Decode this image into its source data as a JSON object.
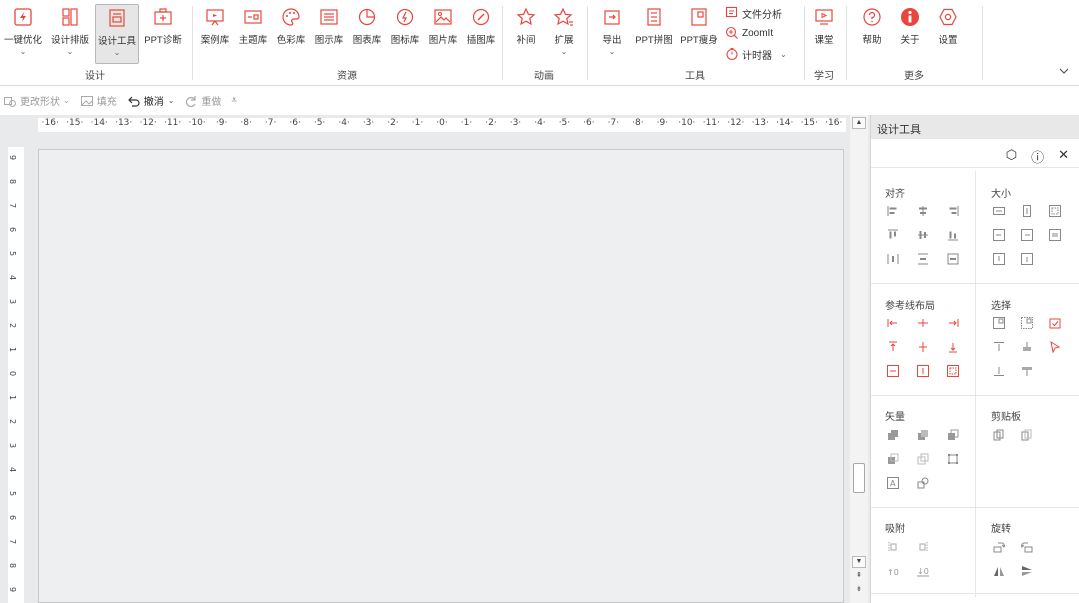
{
  "ribbon": {
    "design": {
      "label": "设计",
      "buttons": [
        {
          "label": "一键优化",
          "icon": "lightning-icon",
          "dropdown": true
        },
        {
          "label": "设计排版",
          "icon": "layout-icon",
          "dropdown": true
        },
        {
          "label": "设计工具",
          "icon": "design-tool-icon",
          "dropdown": true,
          "selected": true
        },
        {
          "label": "PPT诊断",
          "icon": "medical-kit-icon"
        }
      ]
    },
    "resources": {
      "label": "资源",
      "buttons": [
        {
          "label": "案例库",
          "icon": "presentation-icon"
        },
        {
          "label": "主题库",
          "icon": "theme-icon"
        },
        {
          "label": "色彩库",
          "icon": "palette-icon"
        },
        {
          "label": "图示库",
          "icon": "diagram-icon"
        },
        {
          "label": "图表库",
          "icon": "pie-chart-icon"
        },
        {
          "label": "图标库",
          "icon": "icon-library-icon"
        },
        {
          "label": "图片库",
          "icon": "image-icon"
        },
        {
          "label": "插图库",
          "icon": "brush-icon"
        }
      ]
    },
    "animation": {
      "label": "动画",
      "buttons": [
        {
          "label": "补间",
          "icon": "star-icon"
        },
        {
          "label": "扩展",
          "icon": "star-expand-icon",
          "dropdown": true
        }
      ]
    },
    "tools": {
      "label": "工具",
      "buttons": [
        {
          "label": "导出",
          "icon": "export-icon",
          "dropdown": true
        },
        {
          "label": "PPT拼图",
          "icon": "puzzle-icon"
        },
        {
          "label": "PPT瘦身",
          "icon": "compress-icon"
        }
      ],
      "small_buttons": [
        {
          "label": "文件分析",
          "icon": "file-analysis-icon"
        },
        {
          "label": "ZoomIt",
          "icon": "zoom-icon"
        },
        {
          "label": "计时器",
          "icon": "timer-icon",
          "dropdown": true
        }
      ]
    },
    "learn": {
      "label": "学习",
      "buttons": [
        {
          "label": "课堂",
          "icon": "classroom-icon"
        }
      ]
    },
    "more": {
      "label": "更多",
      "buttons": [
        {
          "label": "帮助",
          "icon": "help-icon"
        },
        {
          "label": "关于",
          "icon": "about-icon"
        },
        {
          "label": "设置",
          "icon": "settings-icon"
        }
      ]
    },
    "collapse_icon": "chevron-down-icon"
  },
  "quickbar": {
    "items": [
      {
        "label": "更改形状",
        "icon": "change-shape-icon",
        "dropdown": true,
        "enabled": false
      },
      {
        "label": "填充",
        "icon": "fill-icon",
        "enabled": false
      },
      {
        "label": "撤消",
        "icon": "undo-icon",
        "dropdown": true,
        "enabled": true
      },
      {
        "label": "重做",
        "icon": "redo-icon",
        "enabled": false
      }
    ]
  },
  "ruler": {
    "horizontal": [
      "16",
      "15",
      "14",
      "13",
      "12",
      "11",
      "10",
      "9",
      "8",
      "7",
      "6",
      "5",
      "4",
      "3",
      "2",
      "1",
      "0",
      "1",
      "2",
      "3",
      "4",
      "5",
      "6",
      "7",
      "8",
      "9",
      "10",
      "11",
      "12",
      "13",
      "14",
      "15",
      "16"
    ],
    "vertical": [
      "9",
      "8",
      "7",
      "6",
      "5",
      "4",
      "3",
      "2",
      "1",
      "0",
      "1",
      "2",
      "3",
      "4",
      "5",
      "6",
      "7",
      "8",
      "9"
    ]
  },
  "panel": {
    "title": "设计工具",
    "sections": {
      "align": "对齐",
      "size": "大小",
      "guides": "参考线布局",
      "select": "选择",
      "vector": "矢量",
      "clipboard": "剪贴板",
      "snap": "吸附",
      "rotate": "旋转"
    },
    "colors": {
      "accent": "#e8453c",
      "icon_gray": "#8a8a8a"
    }
  }
}
